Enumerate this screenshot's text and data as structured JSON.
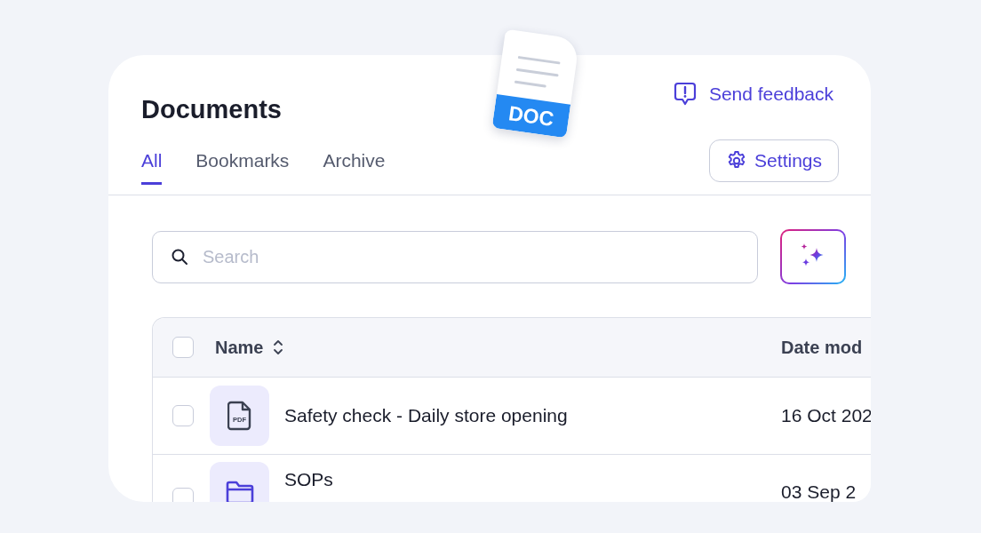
{
  "header": {
    "title": "Documents",
    "feedback_link": "Send feedback",
    "settings_button": "Settings"
  },
  "sticker": {
    "label": "DOC"
  },
  "tabs": [
    {
      "label": "All",
      "selected": true
    },
    {
      "label": "Bookmarks",
      "selected": false
    },
    {
      "label": "Archive",
      "selected": false
    }
  ],
  "search": {
    "placeholder": "Search"
  },
  "table": {
    "header_checked": false,
    "columns": [
      "Name",
      "Date mod"
    ],
    "rows": [
      {
        "kind": "pdf",
        "icon_label": "PDF",
        "name": "Safety check - Daily store opening",
        "date": "16 Oct 202",
        "checked": false
      },
      {
        "kind": "folder",
        "name": "SOPs",
        "date": "03 Sep 2",
        "checked": false
      }
    ]
  }
}
